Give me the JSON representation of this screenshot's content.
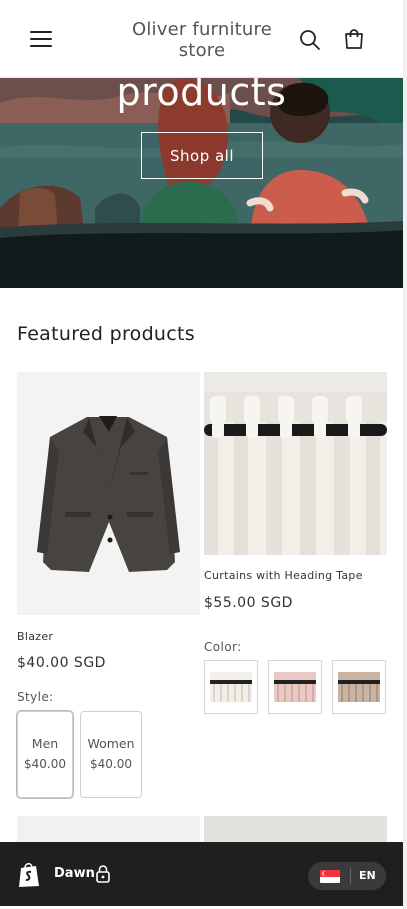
{
  "header": {
    "store_name": "Oliver furniture store",
    "menu_icon": "hamburger-menu-icon",
    "search_icon": "search-icon",
    "cart_icon": "cart-bag-icon"
  },
  "hero": {
    "title": "products",
    "button_label": "Shop all"
  },
  "featured": {
    "title": "Featured products",
    "products": [
      {
        "title": "Blazer",
        "price": "$40.00 SGD",
        "option_label": "Style:",
        "variants": [
          {
            "name": "Men",
            "price": "$40.00"
          },
          {
            "name": "Women",
            "price": "$40.00"
          }
        ]
      },
      {
        "title": "Curtains with Heading Tape",
        "price": "$55.00 SGD",
        "option_label": "Color:",
        "swatch_colors": [
          "#f2f0e8",
          "#e8c9c3",
          "#c9b4a3"
        ]
      }
    ]
  },
  "bottom_bar": {
    "theme_name": "Dawn",
    "lock_icon": "lock-icon",
    "shopify_icon": "shopify-bag-icon",
    "language_code": "EN",
    "flag_icon": "singapore-flag-icon"
  },
  "colors": {
    "hero_bg": "#1e3a3e",
    "bottom_bar_bg": "#1f1f1f",
    "text": "#121212"
  }
}
